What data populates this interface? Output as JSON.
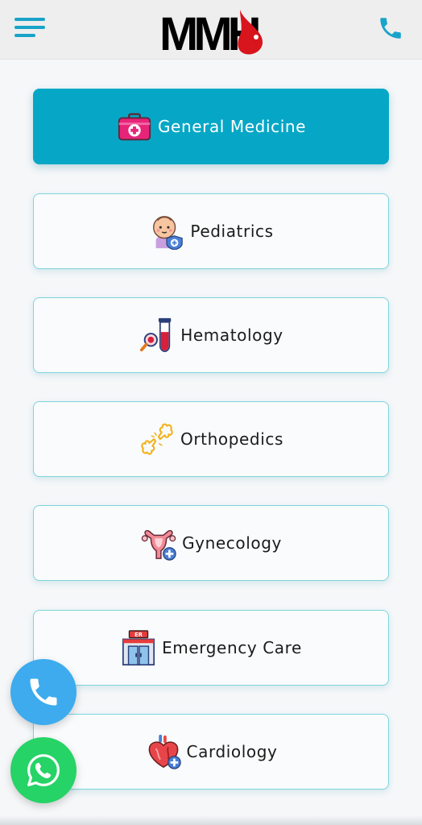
{
  "header": {
    "logo_text": "MMH",
    "menu_icon": "hamburger-menu-icon",
    "phone_icon": "phone-icon",
    "accent_color": "#1aa3c9"
  },
  "departments": [
    {
      "label": "General Medicine",
      "icon": "first-aid-kit-icon",
      "active": true
    },
    {
      "label": "Pediatrics",
      "icon": "baby-icon",
      "active": false
    },
    {
      "label": "Hematology",
      "icon": "blood-test-tube-icon",
      "active": false
    },
    {
      "label": "Orthopedics",
      "icon": "broken-bone-icon",
      "active": false
    },
    {
      "label": "Gynecology",
      "icon": "uterus-icon",
      "active": false
    },
    {
      "label": "Emergency Care",
      "icon": "emergency-room-icon",
      "active": false
    },
    {
      "label": "Cardiology",
      "icon": "heart-icon",
      "active": false
    }
  ],
  "floating_buttons": {
    "call_icon": "phone-icon",
    "whatsapp_icon": "whatsapp-icon"
  },
  "colors": {
    "active_bg": "#06a7c6",
    "card_border": "#7fd3de",
    "call_button": "#3dabee",
    "whatsapp_button": "#26d366",
    "logo_red": "#d8141c"
  }
}
